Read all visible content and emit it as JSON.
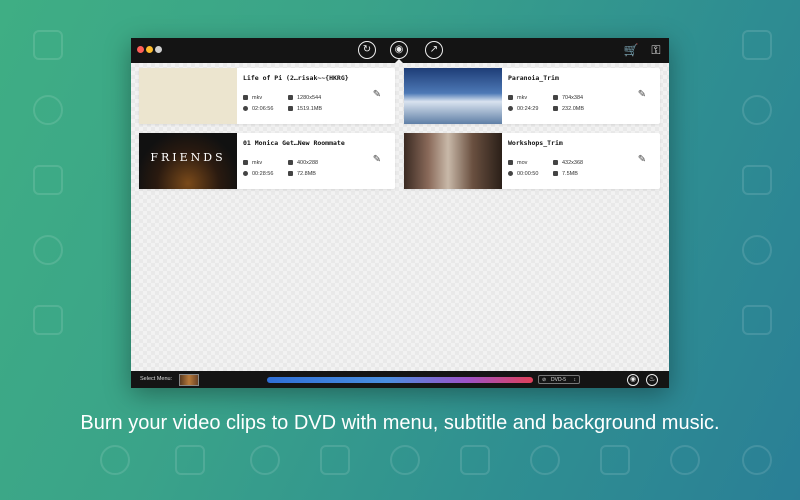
{
  "caption": "Burn your video clips to DVD with menu, subtitle and background music.",
  "titlebar": {
    "traffic_lights": [
      "#ff5f57",
      "#febc2e",
      "#d0d0d0"
    ],
    "buttons": [
      {
        "name": "convert-icon",
        "glyph": "↻"
      },
      {
        "name": "burn-disc-icon",
        "glyph": "◉"
      },
      {
        "name": "export-icon",
        "glyph": "↗"
      }
    ],
    "right_icons": [
      {
        "name": "cart-icon",
        "glyph": "🛒"
      },
      {
        "name": "register-icon",
        "glyph": "⚿"
      }
    ]
  },
  "clips": [
    {
      "title": "Life of Pi (2…risak~~{HKRG}",
      "format": "mkv",
      "resolution": "1280x544",
      "duration": "02:06:56",
      "size": "1519.1MB"
    },
    {
      "title": "Paranoia_Trim",
      "format": "mkv",
      "resolution": "704x384",
      "duration": "00:24:29",
      "size": "232.0MB"
    },
    {
      "title": "01 Monica Get…New Roommate",
      "format": "mkv",
      "resolution": "400x288",
      "duration": "00:28:56",
      "size": "72.8MB",
      "thumb_text": "FRIENDS"
    },
    {
      "title": "Workshops_Trim",
      "format": "mov",
      "resolution": "432x368",
      "duration": "00:00:50",
      "size": "7.5MB"
    }
  ],
  "bottombar": {
    "select_menu_label": "Select Menu:",
    "disc_type": "DVD-5",
    "progress_colors": [
      "#2f6fd6",
      "#9c52c8",
      "#e0405a"
    ]
  }
}
